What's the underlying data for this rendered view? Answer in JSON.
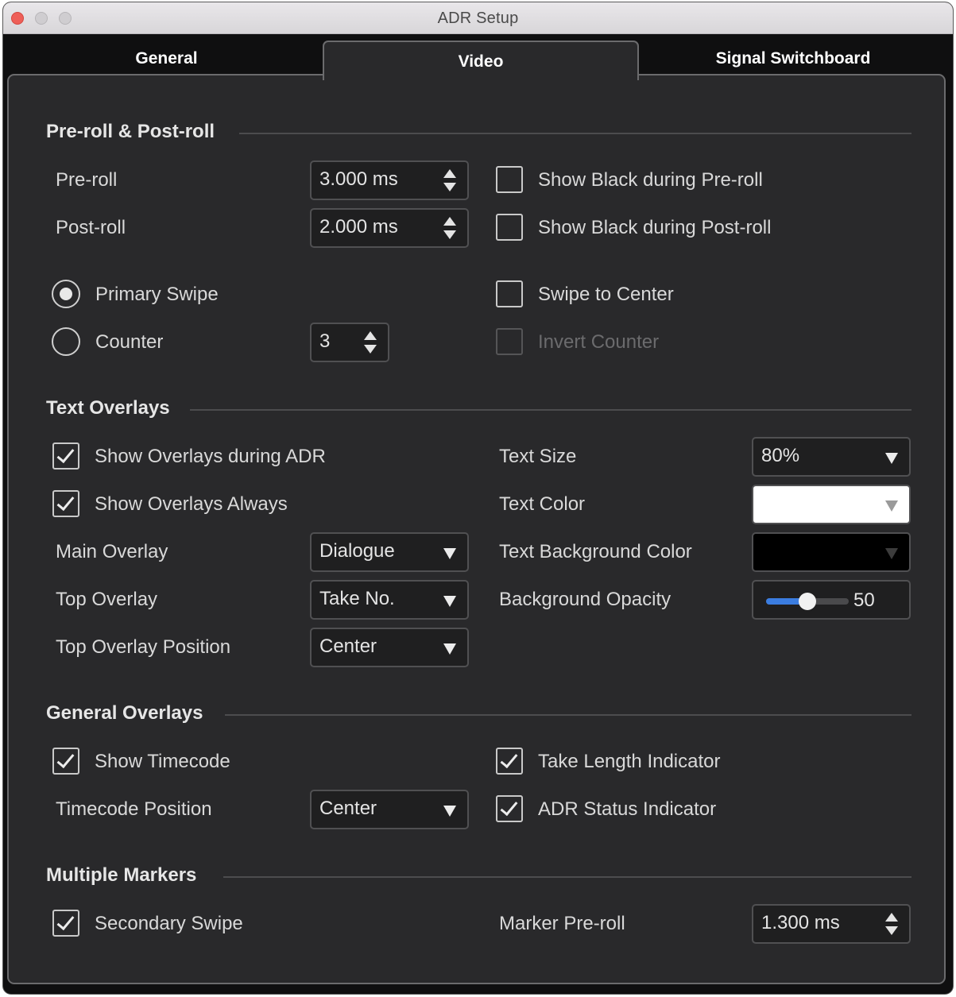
{
  "window": {
    "title": "ADR Setup"
  },
  "tabs": {
    "general": "General",
    "video": "Video",
    "signal_switchboard": "Signal Switchboard"
  },
  "preroll_section": {
    "title": "Pre-roll & Post-roll",
    "preroll_label": "Pre-roll",
    "preroll_value": "3.000 ms",
    "postroll_label": "Post-roll",
    "postroll_value": "2.000 ms",
    "show_black_preroll": {
      "label": "Show Black during Pre-roll",
      "checked": false
    },
    "show_black_postroll": {
      "label": "Show Black during Post-roll",
      "checked": false
    },
    "primary_swipe": {
      "label": "Primary Swipe",
      "selected": true
    },
    "counter": {
      "label": "Counter",
      "selected": false,
      "value": "3"
    },
    "swipe_to_center": {
      "label": "Swipe to Center",
      "checked": false
    },
    "invert_counter": {
      "label": "Invert Counter",
      "checked": false,
      "enabled": false
    }
  },
  "text_overlays": {
    "title": "Text Overlays",
    "show_during_adr": {
      "label": "Show Overlays during ADR",
      "checked": true
    },
    "show_always": {
      "label": "Show Overlays Always",
      "checked": true
    },
    "main_overlay": {
      "label": "Main Overlay",
      "value": "Dialogue"
    },
    "top_overlay": {
      "label": "Top Overlay",
      "value": "Take No."
    },
    "top_overlay_position": {
      "label": "Top Overlay Position",
      "value": "Center"
    },
    "text_size": {
      "label": "Text Size",
      "value": "80%"
    },
    "text_color": {
      "label": "Text Color",
      "color": "#ffffff"
    },
    "text_background_color": {
      "label": "Text Background Color",
      "color": "#000000"
    },
    "background_opacity": {
      "label": "Background Opacity",
      "value": "50",
      "fraction": 0.5
    }
  },
  "general_overlays": {
    "title": "General Overlays",
    "show_timecode": {
      "label": "Show Timecode",
      "checked": true
    },
    "timecode_position": {
      "label": "Timecode Position",
      "value": "Center"
    },
    "take_length_indicator": {
      "label": "Take Length Indicator",
      "checked": true
    },
    "adr_status_indicator": {
      "label": "ADR Status Indicator",
      "checked": true
    }
  },
  "multiple_markers": {
    "title": "Multiple Markers",
    "secondary_swipe": {
      "label": "Secondary Swipe",
      "checked": true
    },
    "marker_preroll": {
      "label": "Marker Pre-roll",
      "value": "1.300 ms"
    }
  },
  "colors": {
    "panel": "#29292b",
    "accent": "#3b7de0"
  }
}
